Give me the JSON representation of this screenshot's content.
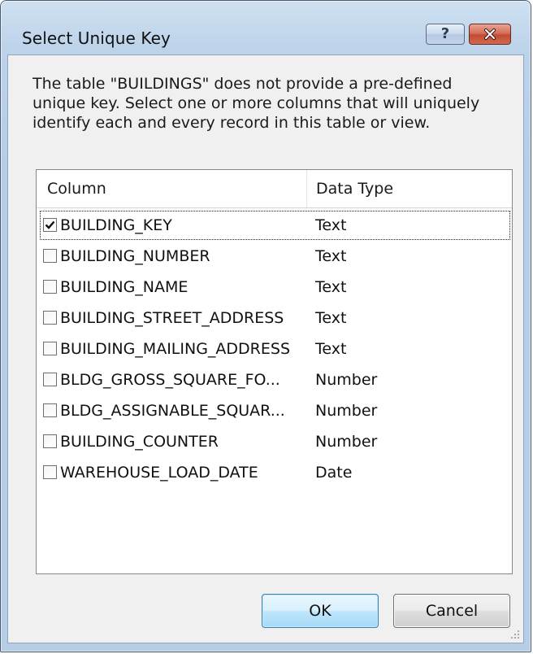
{
  "dialog": {
    "title": "Select Unique Key",
    "help_icon": "question-mark-icon",
    "close_icon": "close-x-icon",
    "description": "The table \"BUILDINGS\" does not provide a pre-defined unique key. Select one or more columns that will uniquely identify each and every record in this table or view.",
    "ok_label": "OK",
    "cancel_label": "Cancel"
  },
  "grid": {
    "headers": {
      "column": "Column",
      "data_type": "Data Type"
    },
    "rows": [
      {
        "name": "BUILDING_KEY",
        "type": "Text",
        "checked": true
      },
      {
        "name": "BUILDING_NUMBER",
        "type": "Text",
        "checked": false
      },
      {
        "name": "BUILDING_NAME",
        "type": "Text",
        "checked": false
      },
      {
        "name": "BUILDING_STREET_ADDRESS",
        "type": "Text",
        "checked": false
      },
      {
        "name": "BUILDING_MAILING_ADDRESS",
        "type": "Text",
        "checked": false
      },
      {
        "name": "BLDG_GROSS_SQUARE_FO...",
        "type": "Number",
        "checked": false
      },
      {
        "name": "BLDG_ASSIGNABLE_SQUAR...",
        "type": "Number",
        "checked": false
      },
      {
        "name": "BUILDING_COUNTER",
        "type": "Number",
        "checked": false
      },
      {
        "name": "WAREHOUSE_LOAD_DATE",
        "type": "Date",
        "checked": false
      }
    ]
  },
  "colors": {
    "title_bar": "#bcd3ea",
    "client_bg": "#f0f0f0",
    "close_button": "#c24a33",
    "default_button_border": "#3c7fb1"
  }
}
